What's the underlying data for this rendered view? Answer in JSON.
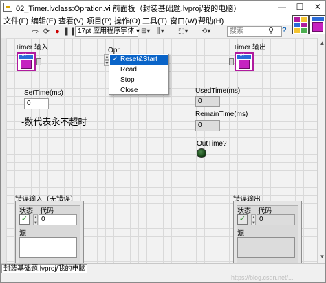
{
  "window": {
    "title": "02_Timer.lvclass:Opration.vi 前面板（封装基础题.lvproj/我的电脑）",
    "minimize": "—",
    "maximize": "☐",
    "close": "✕"
  },
  "menu": [
    "文件(F)",
    "编辑(E)",
    "查看(V)",
    "项目(P)",
    "操作(O)",
    "工具(T)",
    "窗口(W)",
    "帮助(H)"
  ],
  "toolbar": {
    "font": "17pt 应用程序字体",
    "search_placeholder": "搜索",
    "help": "?",
    "icons": [
      "run-arrow-icon",
      "run-continuous-icon",
      "abort-icon",
      "pause-icon",
      "align-icon",
      "distribute-icon",
      "resize-icon",
      "reorder-icon"
    ]
  },
  "controls": {
    "timer_in_label": "Timer 输入",
    "timer_in_icon_text": "02",
    "timer_out_label": "Timer 输出",
    "timer_out_icon_text": "02",
    "opr_label": "Opr",
    "opr_selected": "Reset&Start",
    "opr_options": [
      "Reset&Start",
      "Read",
      "Stop",
      "Close"
    ],
    "settime_label": "SetTime(ms)",
    "settime_value": "0",
    "note": "-数代表永不超时",
    "usedtime_label": "UsedTime(ms)",
    "usedtime_value": "0",
    "remaintime_label": "RemainTime(ms)",
    "remaintime_value": "0",
    "outtime_label": "OutTime?",
    "outtime_state": false
  },
  "error_in": {
    "label": "错误输入（无错误）",
    "status_label": "状态",
    "code_label": "代码",
    "code_value": "0",
    "source_label": "源",
    "status_ok": true
  },
  "error_out": {
    "label": "错误输出",
    "status_label": "状态",
    "code_label": "代码",
    "code_value": "0",
    "source_label": "源",
    "status_ok": true
  },
  "status": {
    "path": "封装基础题.lvproj/我的电脑"
  },
  "watermark": "https://blog.csdn.net/...",
  "colors": {
    "class_icon_border": "#b01a9e",
    "class_icon_fill": "#c522c0",
    "selection": "#0a64c8",
    "check_green": "#2a8a2a",
    "led_off": "#1f5a1f"
  }
}
